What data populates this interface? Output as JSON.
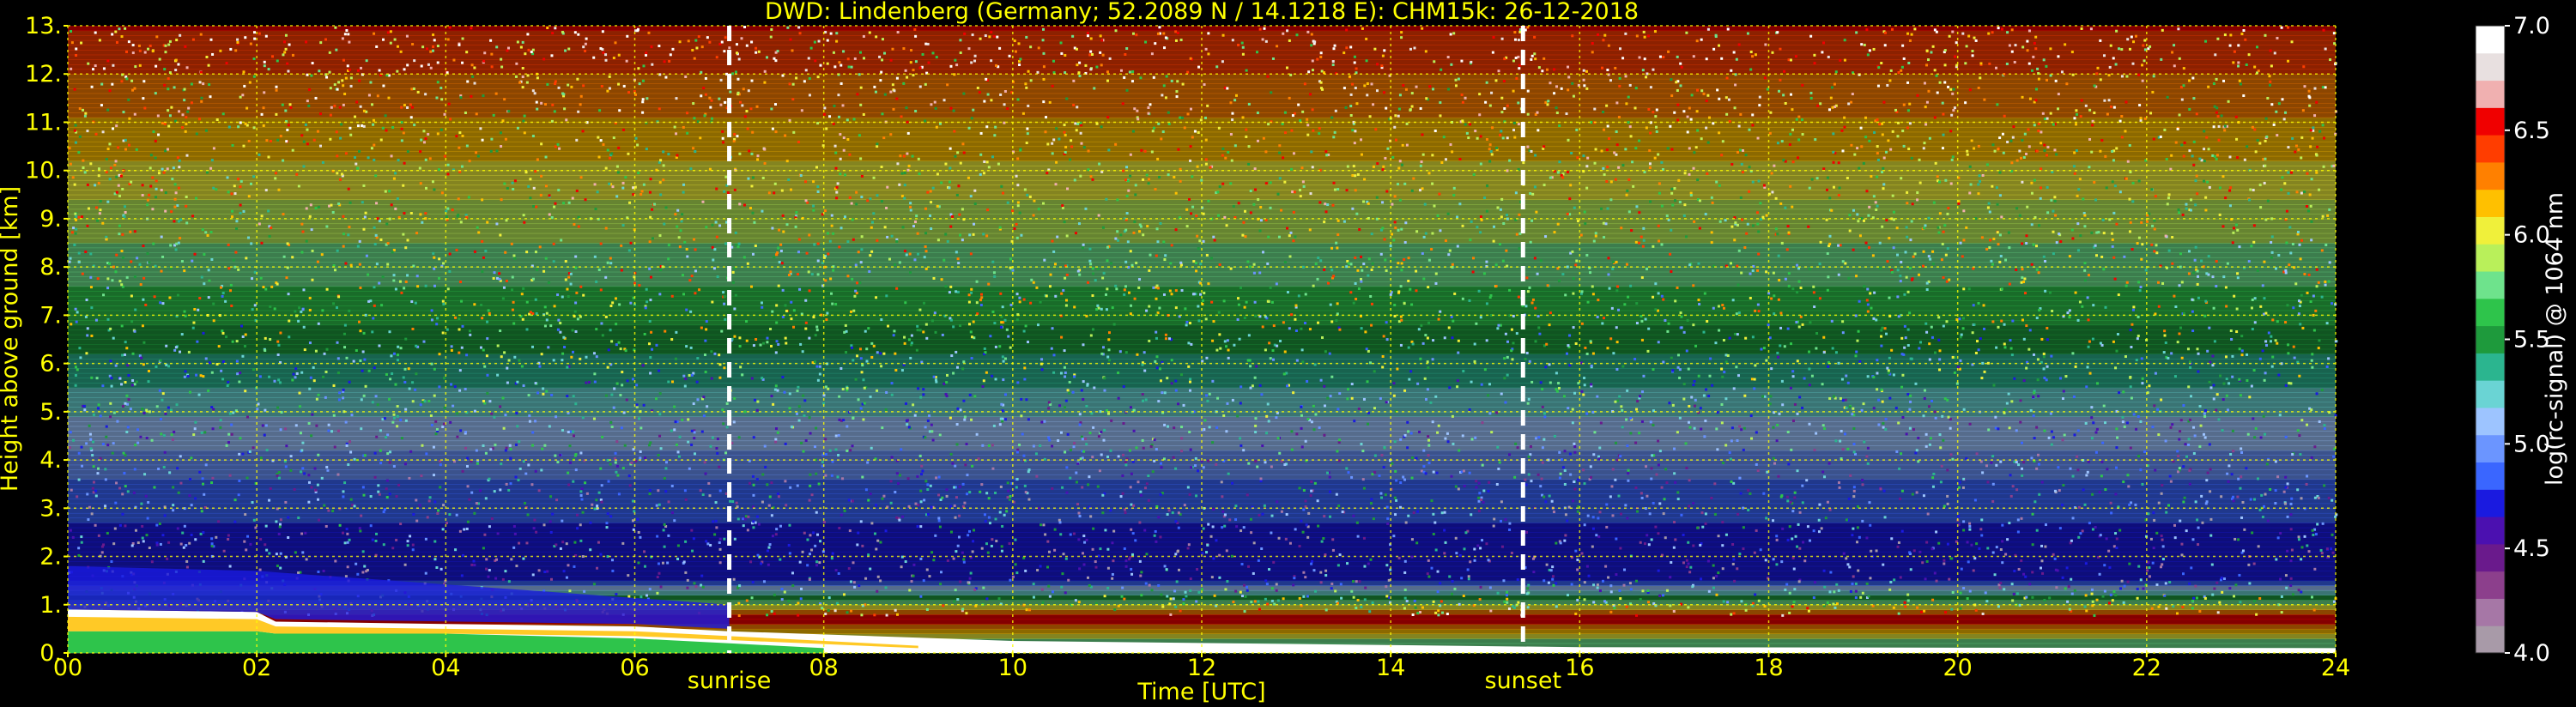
{
  "chart_data": {
    "type": "heatmap",
    "title": "DWD: Lindenberg (Germany; 52.2089 N / 14.1218 E):    CHM15k: 26-12-2018",
    "xlabel": "Time [UTC]",
    "ylabel": "Height above ground [km]",
    "colorbar_label": "log(rc-signal) @ 1064 nm",
    "xlim": [
      0,
      24
    ],
    "ylim": [
      0,
      13
    ],
    "clim": [
      4.0,
      7.0
    ],
    "x_ticks": [
      "00",
      "02",
      "04",
      "06",
      "08",
      "10",
      "12",
      "14",
      "16",
      "18",
      "20",
      "22",
      "24"
    ],
    "y_ticks": [
      "0.",
      "1.",
      "2.",
      "3.",
      "4.",
      "5.",
      "6.",
      "7.",
      "8.",
      "9.",
      "10.",
      "11.",
      "12.",
      "13."
    ],
    "colorbar_ticks": [
      "4.0",
      "4.5",
      "5.0",
      "5.5",
      "6.0",
      "6.5",
      "7.0"
    ],
    "grid": true,
    "markers": [
      {
        "name": "sunrise",
        "x": 7.0
      },
      {
        "name": "sunset",
        "x": 15.4
      }
    ],
    "profile_summary": [
      {
        "height_km": 0.2,
        "value": 5.7
      },
      {
        "height_km": 0.7,
        "value": 6.6
      },
      {
        "height_km": 1.5,
        "value": 4.7
      },
      {
        "height_km": 3.0,
        "value": 4.8
      },
      {
        "height_km": 5.0,
        "value": 5.2
      },
      {
        "height_km": 7.0,
        "value": 5.6
      },
      {
        "height_km": 9.0,
        "value": 5.9
      },
      {
        "height_km": 11.0,
        "value": 6.2
      },
      {
        "height_km": 13.0,
        "value": 6.5
      }
    ],
    "boundary_layer_top_km": [
      {
        "x": 0.0,
        "y": 0.9
      },
      {
        "x": 2.0,
        "y": 0.85
      },
      {
        "x": 2.2,
        "y": 0.65
      },
      {
        "x": 4.0,
        "y": 0.6
      },
      {
        "x": 6.0,
        "y": 0.55
      },
      {
        "x": 7.0,
        "y": 0.45
      },
      {
        "x": 10.0,
        "y": 0.25
      },
      {
        "x": 16.0,
        "y": 0.12
      },
      {
        "x": 24.0,
        "y": 0.1
      }
    ],
    "colormap": [
      "#a89aa8",
      "#a677a6",
      "#8c3f8c",
      "#6a1a8c",
      "#4b10b0",
      "#1a1ae0",
      "#3a66ff",
      "#6b95ff",
      "#9dc4ff",
      "#6ad4d4",
      "#2bb58f",
      "#1e9a3c",
      "#2ec44b",
      "#6ee38c",
      "#b9f05a",
      "#f0f03a",
      "#ffc000",
      "#ff8000",
      "#ff3d00",
      "#f00000",
      "#f0b0b0",
      "#e8e0e0",
      "#ffffff"
    ]
  }
}
